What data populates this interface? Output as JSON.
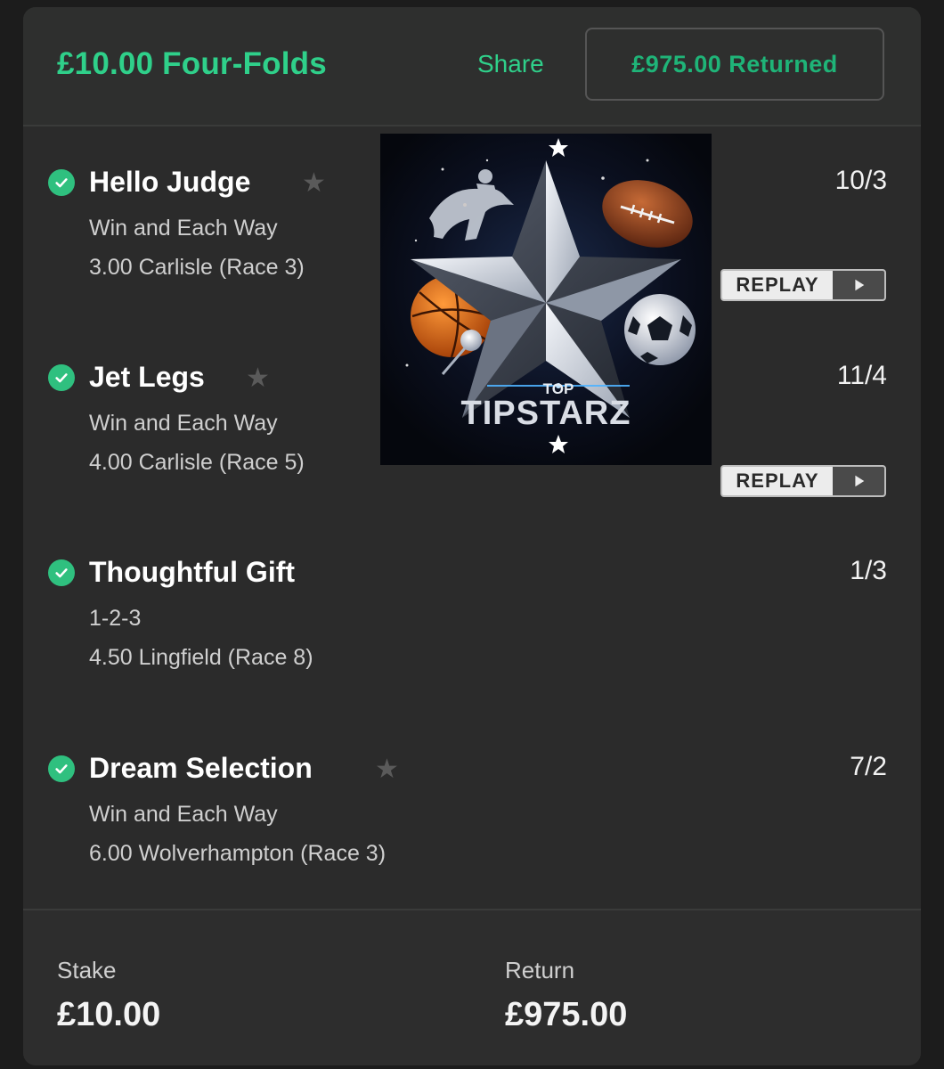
{
  "header": {
    "title": "£10.00 Four-Folds",
    "share_label": "Share",
    "returned_label": "£975.00 Returned"
  },
  "selections": [
    {
      "name": "Hello Judge",
      "market": "Win and Each Way",
      "event": "3.00 Carlisle (Race 3)",
      "odds": "10/3",
      "has_star": true,
      "replay": "REPLAY"
    },
    {
      "name": "Jet Legs",
      "market": "Win and Each Way",
      "event": "4.00 Carlisle (Race 5)",
      "odds": "11/4",
      "has_star": true,
      "replay": "REPLAY"
    },
    {
      "name": "Thoughtful Gift",
      "market": "1-2-3",
      "event": "4.50 Lingfield (Race 8)",
      "odds": "1/3",
      "has_star": false
    },
    {
      "name": "Dream Selection",
      "market": "Win and Each Way",
      "event": "6.00 Wolverhampton (Race 3)",
      "odds": "7/2",
      "has_star": true
    }
  ],
  "logo": {
    "line1": "TOP",
    "line2": "TIPSTARZ"
  },
  "footer": {
    "stake_label": "Stake",
    "stake_value": "£10.00",
    "return_label": "Return",
    "return_value": "£975.00"
  },
  "colors": {
    "accent": "#2fd08a",
    "check": "#2fc07f",
    "background": "#2b2b2b"
  }
}
